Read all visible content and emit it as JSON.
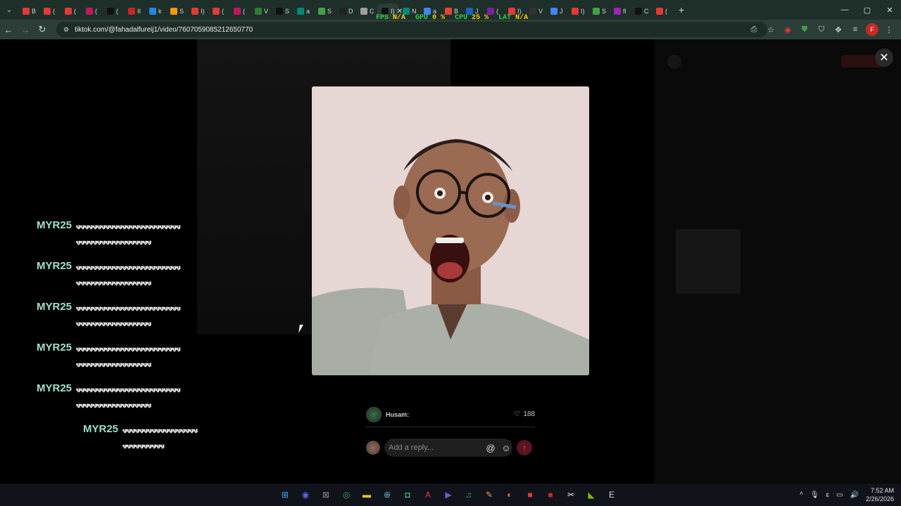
{
  "browser": {
    "tabs": [
      {
        "label": "B",
        "color": "#e53935"
      },
      {
        "label": "(",
        "color": "#e53935"
      },
      {
        "label": "(",
        "color": "#e53935"
      },
      {
        "label": "(",
        "color": "#c2185b"
      },
      {
        "label": "(",
        "color": "#111111"
      },
      {
        "label": "II",
        "color": "#c62828"
      },
      {
        "label": "k",
        "color": "#1e88e5"
      },
      {
        "label": "S",
        "color": "#ff9800"
      },
      {
        "label": "I)",
        "color": "#e53935"
      },
      {
        "label": "(",
        "color": "#e53935"
      },
      {
        "label": "(",
        "color": "#c2185b"
      },
      {
        "label": "V",
        "color": "#2e7d32"
      },
      {
        "label": "S",
        "color": "#111111"
      },
      {
        "label": "a",
        "color": "#00897b"
      },
      {
        "label": "S",
        "color": "#43a047"
      },
      {
        "label": "D",
        "color": "#222222"
      },
      {
        "label": "C",
        "color": "#9e9e9e"
      },
      {
        "label": "I)",
        "color": "#111111",
        "active": true
      },
      {
        "label": "N",
        "color": "#00897b"
      },
      {
        "label": "a",
        "color": "#4285f4"
      },
      {
        "label": "B",
        "color": "#ea4335"
      },
      {
        "label": "J",
        "color": "#1565c0"
      },
      {
        "label": "(",
        "color": "#7b1fa2"
      },
      {
        "label": "I)",
        "color": "#e53935"
      },
      {
        "label": "V",
        "color": "#333333"
      },
      {
        "label": "J",
        "color": "#4285f4"
      },
      {
        "label": "I)",
        "color": "#e53935"
      },
      {
        "label": "S",
        "color": "#43a047"
      },
      {
        "label": "fi",
        "color": "#9c27b0"
      },
      {
        "label": "C",
        "color": "#111111"
      },
      {
        "label": "(",
        "color": "#e53935"
      }
    ],
    "url": "tiktok.com/@fahadalfureij1/video/7607059085212650770",
    "window_controls": [
      "—",
      "▢",
      "✕"
    ]
  },
  "overlay": {
    "fps_label": "FPS",
    "fps_value": "N/A",
    "gpu_label": "GPU",
    "gpu_value": "0 %",
    "cpu_label": "CPU",
    "cpu_value": "25 %",
    "lat_label": "LAT",
    "lat_value": "N/A"
  },
  "chat": [
    {
      "name": "MYR25",
      "msg": "ꮰꮰꮰꮰꮰꮰꮰꮰꮰꮰꮰꮰꮰꮰꮰꮰꮰꮰꮰꮰꮰꮰꮰꮰꮰꮰꮰꮰꮰꮰꮰꮰꮰꮰꮰꮰꮰꮰꮰꮰꮰꮰꮰ"
    },
    {
      "name": "MYR25",
      "msg": "ꮰꮰꮰꮰꮰꮰꮰꮰꮰꮰꮰꮰꮰꮰꮰꮰꮰꮰꮰꮰꮰꮰꮰꮰꮰꮰꮰꮰꮰꮰꮰꮰꮰꮰꮰꮰꮰꮰꮰꮰꮰꮰꮰ"
    },
    {
      "name": "MYR25",
      "msg": "ꮰꮰꮰꮰꮰꮰꮰꮰꮰꮰꮰꮰꮰꮰꮰꮰꮰꮰꮰꮰꮰꮰꮰꮰꮰꮰꮰꮰꮰꮰꮰꮰꮰꮰꮰꮰꮰꮰꮰꮰꮰꮰꮰ"
    },
    {
      "name": "MYR25",
      "msg": "ꮰꮰꮰꮰꮰꮰꮰꮰꮰꮰꮰꮰꮰꮰꮰꮰꮰꮰꮰꮰꮰꮰꮰꮰꮰꮰꮰꮰꮰꮰꮰꮰꮰꮰꮰꮰꮰꮰꮰꮰꮰꮰꮰ"
    },
    {
      "name": "MYR25",
      "msg": "ꮰꮰꮰꮰꮰꮰꮰꮰꮰꮰꮰꮰꮰꮰꮰꮰꮰꮰꮰꮰꮰꮰꮰꮰꮰꮰꮰꮰꮰꮰꮰꮰꮰꮰꮰꮰꮰꮰꮰꮰꮰꮰꮰ"
    },
    {
      "name": "MYR25",
      "msg": "ꮰꮰꮰꮰꮰꮰꮰꮰꮰꮰꮰꮰꮰꮰꮰꮰꮰꮰꮰꮰꮰꮰꮰꮰꮰꮰꮰꮰ"
    }
  ],
  "comment": {
    "author": "Husam:",
    "likes": "188"
  },
  "reply": {
    "placeholder": "Add a reply...",
    "at_icon": "@",
    "emoji_icon": "☺",
    "send_icon": "↑"
  },
  "taskbar": {
    "icons": [
      {
        "name": "start-icon",
        "glyph": "⊞",
        "color": "#4aa8ff"
      },
      {
        "name": "discord-icon",
        "glyph": "◉",
        "color": "#5865f2"
      },
      {
        "name": "xbox-icon",
        "glyph": "⊠",
        "color": "#888888"
      },
      {
        "name": "chrome-icon",
        "glyph": "◎",
        "color": "#34a853"
      },
      {
        "name": "folder-icon",
        "glyph": "▬",
        "color": "#f9c513"
      },
      {
        "name": "steam-icon",
        "glyph": "⊛",
        "color": "#66c0f4"
      },
      {
        "name": "android-icon",
        "glyph": "◘",
        "color": "#3ddc84"
      },
      {
        "name": "adobe-icon",
        "glyph": "A",
        "color": "#e63946"
      },
      {
        "name": "media-icon",
        "glyph": "▶",
        "color": "#6a5acd"
      },
      {
        "name": "spotify-icon",
        "glyph": "♫",
        "color": "#1db954"
      },
      {
        "name": "pen-icon",
        "glyph": "✎",
        "color": "#e0a030"
      },
      {
        "name": "firefox-icon",
        "glyph": "◐",
        "color": "#ff7139"
      },
      {
        "name": "record-icon",
        "glyph": "■",
        "color": "#e53935"
      },
      {
        "name": "app-red-icon",
        "glyph": "■",
        "color": "#c62828"
      },
      {
        "name": "capcut-icon",
        "glyph": "✂",
        "color": "#eeeeee"
      },
      {
        "name": "nvidia-icon",
        "glyph": "◣",
        "color": "#76b900"
      },
      {
        "name": "epic-icon",
        "glyph": "E",
        "color": "#dddddd"
      }
    ],
    "tray": {
      "chevron": "^",
      "mic": "🎙",
      "lang": "ε",
      "net": "▭",
      "vol": "🔊",
      "time": "7:52 AM",
      "date": "2/26/2026"
    }
  },
  "colors": {
    "accent_green": "#9fe3c9",
    "send": "#5a1520"
  }
}
